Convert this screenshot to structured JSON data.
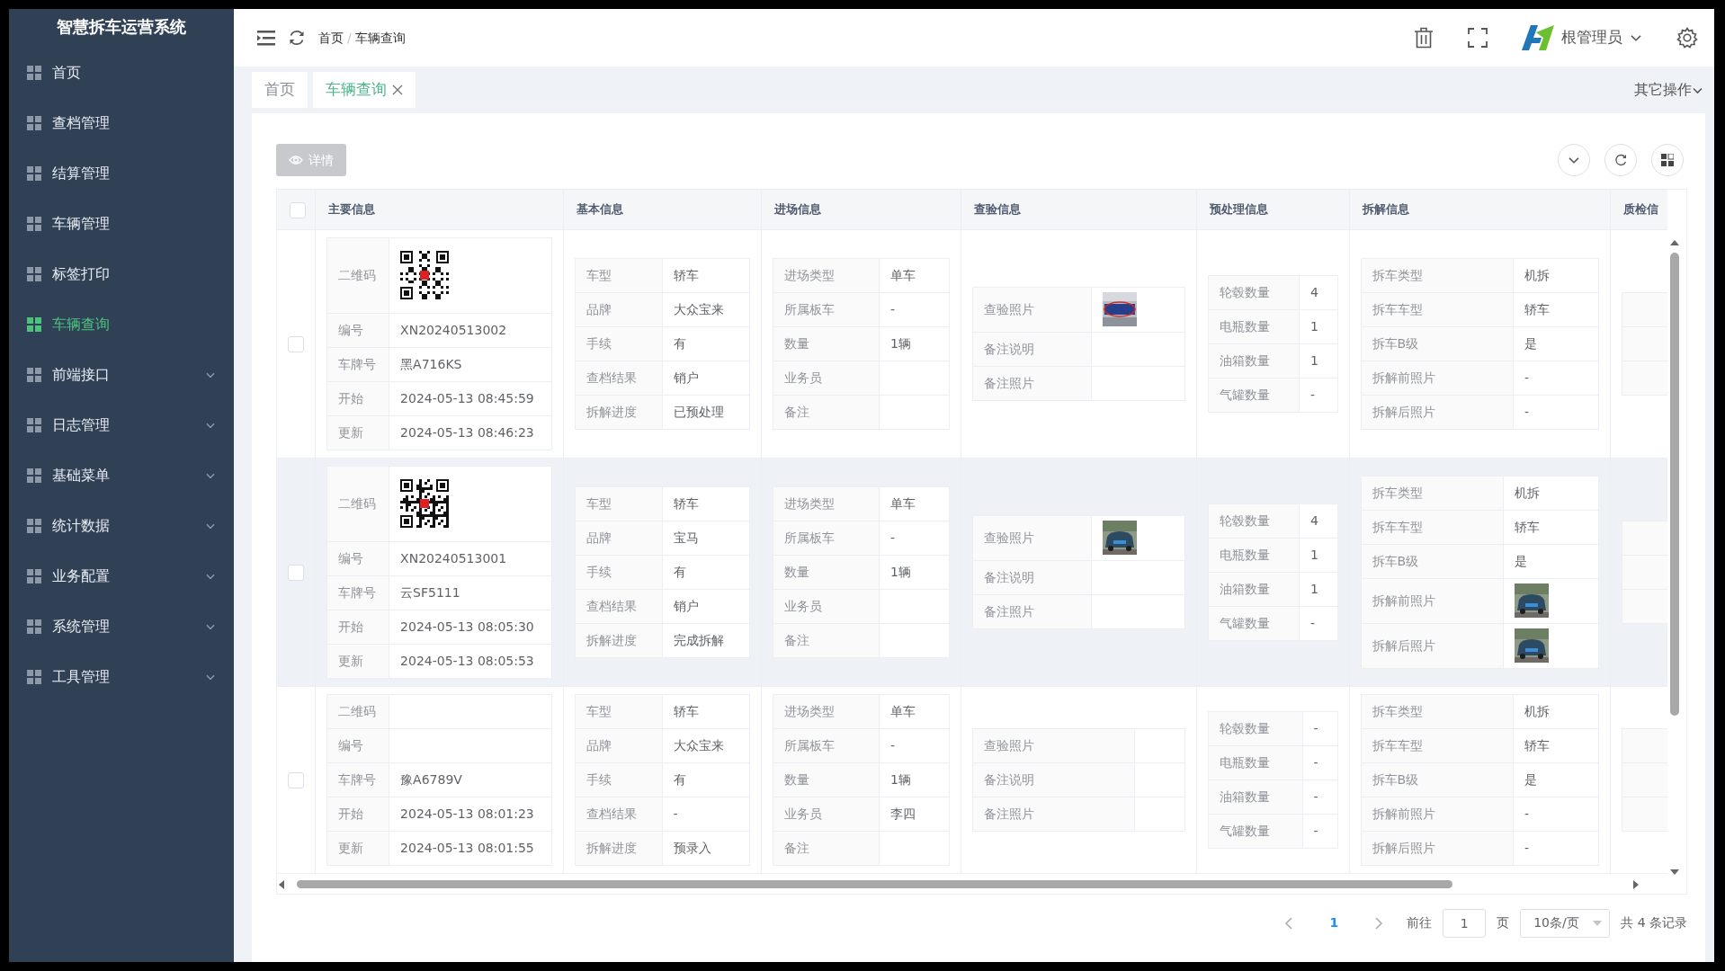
{
  "sidebar": {
    "title": "智慧拆车运营系统",
    "items": [
      {
        "label": "首页",
        "selected": false,
        "expandable": false
      },
      {
        "label": "查档管理",
        "selected": false,
        "expandable": false
      },
      {
        "label": "结算管理",
        "selected": false,
        "expandable": false
      },
      {
        "label": "车辆管理",
        "selected": false,
        "expandable": false
      },
      {
        "label": "标签打印",
        "selected": false,
        "expandable": false
      },
      {
        "label": "车辆查询",
        "selected": true,
        "expandable": false
      },
      {
        "label": "前端接口",
        "selected": false,
        "expandable": true
      },
      {
        "label": "日志管理",
        "selected": false,
        "expandable": true
      },
      {
        "label": "基础菜单",
        "selected": false,
        "expandable": true
      },
      {
        "label": "统计数据",
        "selected": false,
        "expandable": true
      },
      {
        "label": "业务配置",
        "selected": false,
        "expandable": true
      },
      {
        "label": "系统管理",
        "selected": false,
        "expandable": true
      },
      {
        "label": "工具管理",
        "selected": false,
        "expandable": true
      }
    ]
  },
  "header": {
    "breadcrumb": [
      "首页",
      "车辆查询"
    ],
    "breadcrumb_separator": "/",
    "user": "根管理员"
  },
  "tabs": [
    {
      "label": "首页",
      "selected": false,
      "closable": false
    },
    {
      "label": "车辆查询",
      "selected": true,
      "closable": true
    }
  ],
  "other_actions": "其它操作",
  "detail_button": {
    "label": "详情",
    "disabled": true
  },
  "table": {
    "all_checked": false,
    "columns": [
      "主要信息",
      "基本信息",
      "进场信息",
      "查验信息",
      "预处理信息",
      "拆解信息",
      "质检信"
    ],
    "rows": [
      {
        "checked": false,
        "hovered": false,
        "main": [
          {
            "label": "二维码",
            "kind": "qr"
          },
          {
            "label": "编号",
            "kind": "text",
            "value": "XN20240513002"
          },
          {
            "label": "车牌号",
            "kind": "text",
            "value": "黑A716KS"
          },
          {
            "label": "开始",
            "kind": "text",
            "value": "2024-05-13 08:45:59"
          },
          {
            "label": "更新",
            "kind": "text",
            "value": "2024-05-13 08:46:23"
          }
        ],
        "basic": [
          {
            "label": "车型",
            "value": "轿车"
          },
          {
            "label": "品牌",
            "value": "大众宝来"
          },
          {
            "label": "手续",
            "value": "有"
          },
          {
            "label": "查档结果",
            "value": "销户"
          },
          {
            "label": "拆解进度",
            "value": "已预处理"
          }
        ],
        "entry": [
          {
            "label": "进场类型",
            "value": "单车"
          },
          {
            "label": "所属板车",
            "value": "-"
          },
          {
            "label": "数量",
            "value": "1辆"
          },
          {
            "label": "业务员"
          },
          {
            "label": "备注"
          }
        ],
        "inspection": [
          {
            "label": "查验照片"
          },
          {
            "label": "备注说明",
            "kind": "text"
          },
          {
            "label": "备注照片",
            "kind": "text"
          }
        ],
        "preprocess": [
          {
            "label": "轮毂数量",
            "value": "4"
          },
          {
            "label": "电瓶数量",
            "value": "1"
          },
          {
            "label": "油箱数量",
            "value": "1"
          },
          {
            "label": "气罐数量",
            "value": "-"
          }
        ],
        "dismantle": [
          {
            "label": "拆车类型",
            "kind": "text",
            "value": "机拆"
          },
          {
            "label": "拆车车型",
            "kind": "text",
            "value": "轿车"
          },
          {
            "label": "拆车B级",
            "kind": "text",
            "value": "是"
          },
          {
            "label": "拆解前照片",
            "kind": "text",
            "value": "-"
          },
          {
            "label": "拆解后照片",
            "kind": "text",
            "value": "-"
          }
        ]
      },
      {
        "checked": false,
        "hovered": true,
        "main": [
          {
            "label": "二维码",
            "kind": "qr"
          },
          {
            "label": "编号",
            "kind": "text",
            "value": "XN20240513001"
          },
          {
            "label": "车牌号",
            "kind": "text",
            "value": "云SF5111"
          },
          {
            "label": "开始",
            "kind": "text",
            "value": "2024-05-13 08:05:30"
          },
          {
            "label": "更新",
            "kind": "text",
            "value": "2024-05-13 08:05:53"
          }
        ],
        "basic": [
          {
            "label": "车型",
            "value": "轿车"
          },
          {
            "label": "品牌",
            "value": "宝马"
          },
          {
            "label": "手续",
            "value": "有"
          },
          {
            "label": "查档结果",
            "value": "销户"
          },
          {
            "label": "拆解进度",
            "value": "完成拆解"
          }
        ],
        "entry": [
          {
            "label": "进场类型",
            "value": "单车"
          },
          {
            "label": "所属板车",
            "value": "-"
          },
          {
            "label": "数量",
            "value": "1辆"
          },
          {
            "label": "业务员"
          },
          {
            "label": "备注"
          }
        ],
        "inspection": [
          {
            "label": "查验照片"
          },
          {
            "label": "备注说明",
            "kind": "text"
          },
          {
            "label": "备注照片",
            "kind": "text"
          }
        ],
        "preprocess": [
          {
            "label": "轮毂数量",
            "value": "4"
          },
          {
            "label": "电瓶数量",
            "value": "1"
          },
          {
            "label": "油箱数量",
            "value": "1"
          },
          {
            "label": "气罐数量",
            "value": "-"
          }
        ],
        "dismantle": [
          {
            "label": "拆车类型",
            "kind": "text",
            "value": "机拆"
          },
          {
            "label": "拆车车型",
            "kind": "text",
            "value": "轿车"
          },
          {
            "label": "拆车B级",
            "kind": "text",
            "value": "是"
          },
          {
            "label": "拆解前照片"
          },
          {
            "label": "拆解后照片"
          }
        ]
      },
      {
        "checked": false,
        "hovered": false,
        "main": [
          {
            "label": "二维码",
            "kind": "text"
          },
          {
            "label": "编号",
            "kind": "text"
          },
          {
            "label": "车牌号",
            "kind": "text",
            "value": "豫A6789V"
          },
          {
            "label": "开始",
            "kind": "text",
            "value": "2024-05-13 08:01:23"
          },
          {
            "label": "更新",
            "kind": "text",
            "value": "2024-05-13 08:01:55"
          }
        ],
        "basic": [
          {
            "label": "车型",
            "value": "轿车"
          },
          {
            "label": "品牌",
            "value": "大众宝来"
          },
          {
            "label": "手续",
            "value": "有"
          },
          {
            "label": "查档结果",
            "value": "-"
          },
          {
            "label": "拆解进度",
            "value": "预录入"
          }
        ],
        "entry": [
          {
            "label": "进场类型",
            "value": "单车"
          },
          {
            "label": "所属板车",
            "value": "-"
          },
          {
            "label": "数量",
            "value": "1辆"
          },
          {
            "label": "业务员",
            "value": "李四"
          },
          {
            "label": "备注"
          }
        ],
        "inspection": [
          {
            "label": "查验照片",
            "kind": "text"
          },
          {
            "label": "备注说明",
            "kind": "text"
          },
          {
            "label": "备注照片",
            "kind": "text"
          }
        ],
        "preprocess": [
          {
            "label": "轮毂数量",
            "value": "-"
          },
          {
            "label": "电瓶数量",
            "value": "-"
          },
          {
            "label": "油箱数量",
            "value": "-"
          },
          {
            "label": "气罐数量",
            "value": "-"
          }
        ],
        "dismantle": [
          {
            "label": "拆车类型",
            "kind": "text",
            "value": "机拆"
          },
          {
            "label": "拆车车型",
            "kind": "text",
            "value": "轿车"
          },
          {
            "label": "拆车B级",
            "kind": "text",
            "value": "是"
          },
          {
            "label": "拆解前照片",
            "kind": "text",
            "value": "-"
          },
          {
            "label": "拆解后照片",
            "kind": "text",
            "value": "-"
          }
        ]
      }
    ]
  },
  "pagination": {
    "current": "1",
    "goto_label": "前往",
    "goto_value": "1",
    "page_unit": "页",
    "page_size": "10条/页",
    "total": "共 4 条记录"
  }
}
